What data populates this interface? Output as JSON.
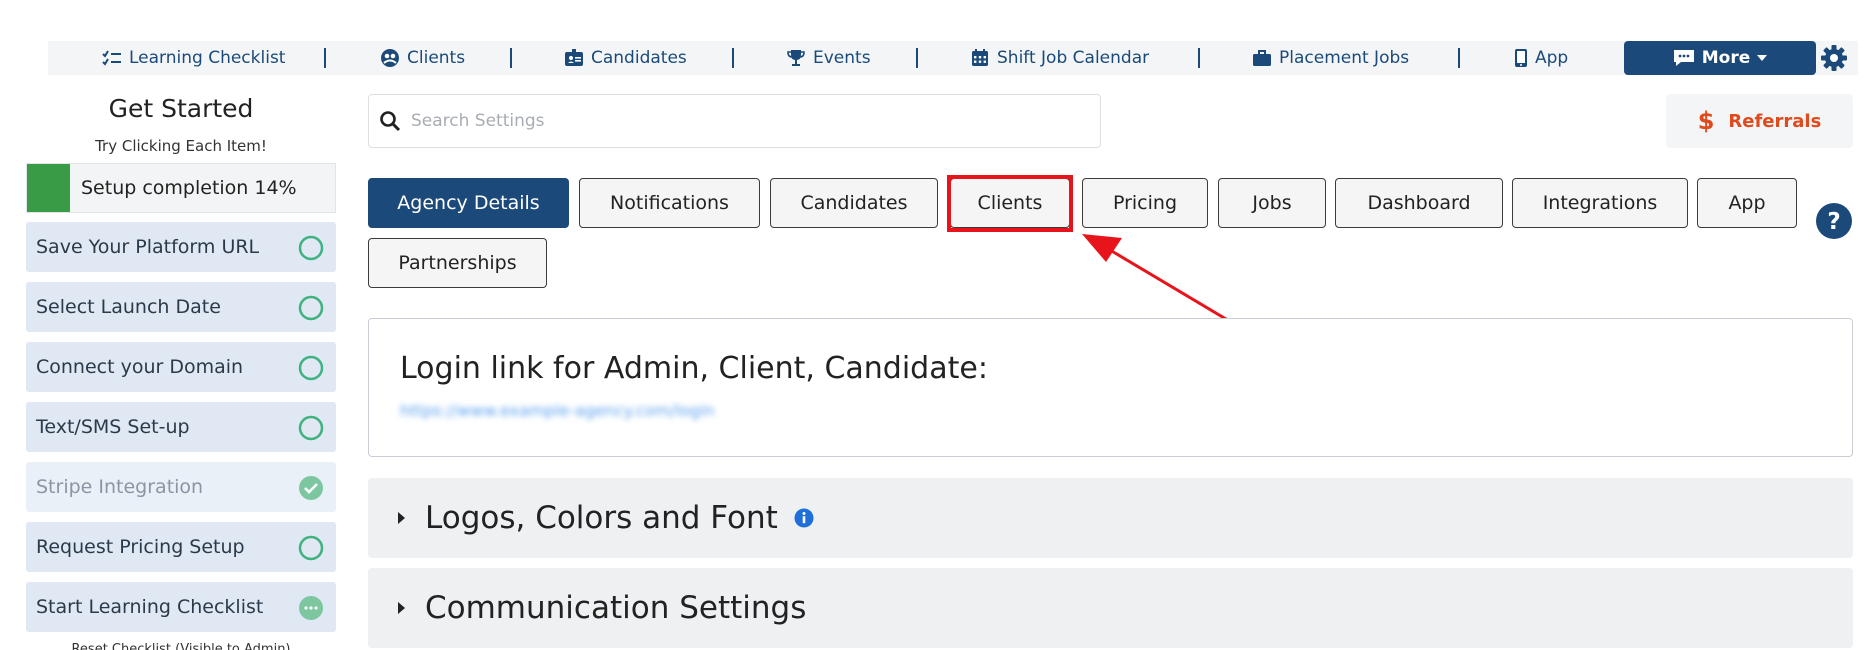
{
  "nav": {
    "items": [
      {
        "label": "Learning Checklist",
        "icon": "checklist-icon"
      },
      {
        "label": "Clients",
        "icon": "clients-icon"
      },
      {
        "label": "Candidates",
        "icon": "candidates-icon"
      },
      {
        "label": "Events",
        "icon": "trophy-icon"
      },
      {
        "label": "Shift Job Calendar",
        "icon": "calendar-icon"
      },
      {
        "label": "Placement Jobs",
        "icon": "briefcase-icon"
      },
      {
        "label": "App",
        "icon": "phone-icon"
      }
    ],
    "more_label": "More",
    "accent": "#1b4a7a"
  },
  "sidebar": {
    "title": "Get Started",
    "subtitle": "Try Clicking Each Item!",
    "progress_label": "Setup completion 14%",
    "progress_fraction": 0.14,
    "items": [
      {
        "label": "Save Your Platform URL",
        "status": "empty-circle"
      },
      {
        "label": "Select Launch Date",
        "status": "empty-circle"
      },
      {
        "label": "Connect your Domain",
        "status": "empty-circle"
      },
      {
        "label": "Text/SMS Set-up",
        "status": "empty-circle"
      },
      {
        "label": "Stripe Integration",
        "status": "check-circle"
      },
      {
        "label": "Request Pricing Setup",
        "status": "empty-circle"
      },
      {
        "label": "Start Learning Checklist",
        "status": "dots-circle"
      }
    ],
    "footer": "Reset Checklist (Visible to Admin)"
  },
  "search": {
    "placeholder": "Search Settings",
    "value": ""
  },
  "referrals": {
    "label": "Referrals",
    "color": "#e04a1c"
  },
  "tabs": [
    {
      "label": "Agency Details",
      "active": true
    },
    {
      "label": "Notifications"
    },
    {
      "label": "Candidates"
    },
    {
      "label": "Clients"
    },
    {
      "label": "Pricing"
    },
    {
      "label": "Jobs"
    },
    {
      "label": "Dashboard"
    },
    {
      "label": "Integrations"
    },
    {
      "label": "App"
    },
    {
      "label": "Partnerships"
    }
  ],
  "login_card": {
    "title": "Login link for Admin, Client, Candidate:",
    "link": "https://www.example-agency.com/login"
  },
  "accordions": [
    {
      "label": "Logos, Colors and Font"
    },
    {
      "label": "Communication Settings"
    }
  ],
  "annotation_color": "#e8141c"
}
